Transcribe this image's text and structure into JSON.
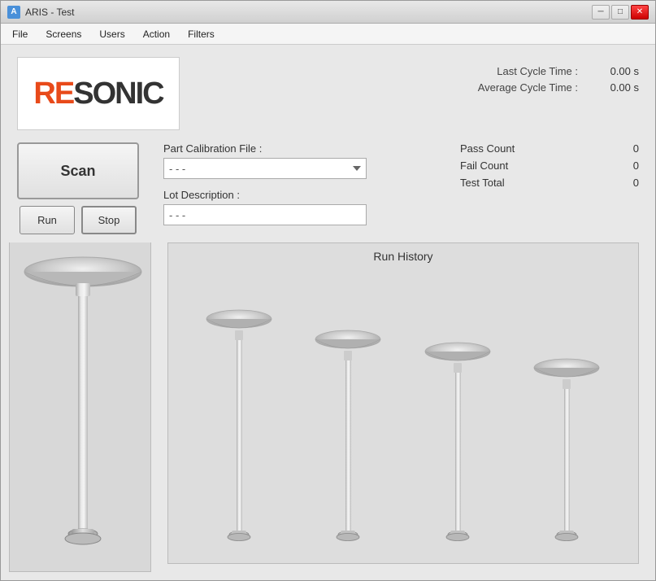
{
  "window": {
    "title": "ARIS - Test",
    "titleIcon": "A"
  },
  "menu": {
    "items": [
      "File",
      "Screens",
      "Users",
      "Action",
      "Filters"
    ]
  },
  "logo": {
    "re": "RE",
    "sonic": "SONIC"
  },
  "cycleStats": {
    "lastCycleLabel": "Last Cycle Time :",
    "lastCycleValue": "0.00 s",
    "avgCycleLabel": "Average Cycle Time :",
    "avgCycleValue": "0.00 s"
  },
  "buttons": {
    "scan": "Scan",
    "run": "Run",
    "stop": "Stop"
  },
  "form": {
    "calFileLabel": "Part Calibration File :",
    "calFileValue": "- - -",
    "calFilePlaceholder": "- - -",
    "lotDescLabel": "Lot Description :",
    "lotDescValue": "- - -"
  },
  "countStats": {
    "passLabel": "Pass Count",
    "passValue": "0",
    "failLabel": "Fail Count",
    "failValue": "0",
    "totalLabel": "Test Total",
    "totalValue": "0"
  },
  "history": {
    "title": "Run History"
  }
}
